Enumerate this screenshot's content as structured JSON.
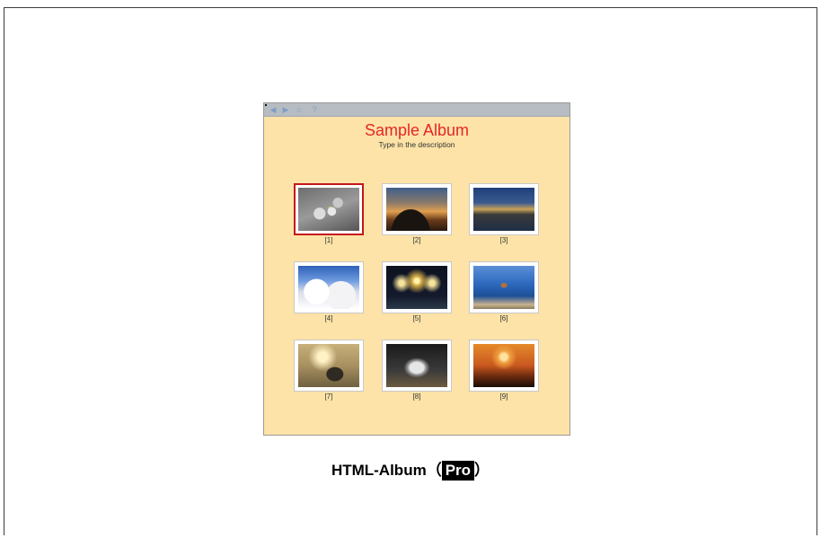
{
  "album": {
    "title": "Sample Album",
    "description": "Type in the description",
    "toolbar": {
      "buttons": [
        {
          "icon": "back-arrow-icon",
          "glyph": "◀"
        },
        {
          "icon": "forward-arrow-icon",
          "glyph": "▶"
        },
        {
          "icon": "home-icon",
          "glyph": "⌂"
        },
        {
          "icon": "help-icon",
          "glyph": "?"
        }
      ]
    },
    "photos": [
      {
        "caption": "[1]",
        "selected": true
      },
      {
        "caption": "[2]",
        "selected": false
      },
      {
        "caption": "[3]",
        "selected": false
      },
      {
        "caption": "[4]",
        "selected": false
      },
      {
        "caption": "[5]",
        "selected": false
      },
      {
        "caption": "[6]",
        "selected": false
      },
      {
        "caption": "[7]",
        "selected": false
      },
      {
        "caption": "[8]",
        "selected": false
      },
      {
        "caption": "[9]",
        "selected": false
      }
    ]
  },
  "footer": {
    "prefix": "HTML-Album（",
    "badge": "Pro",
    "suffix": "）"
  },
  "colors": {
    "album_background": "#fde3a7",
    "title": "#e5252a",
    "selection": "#c4161c",
    "toolbar": "#b7bcc2"
  }
}
